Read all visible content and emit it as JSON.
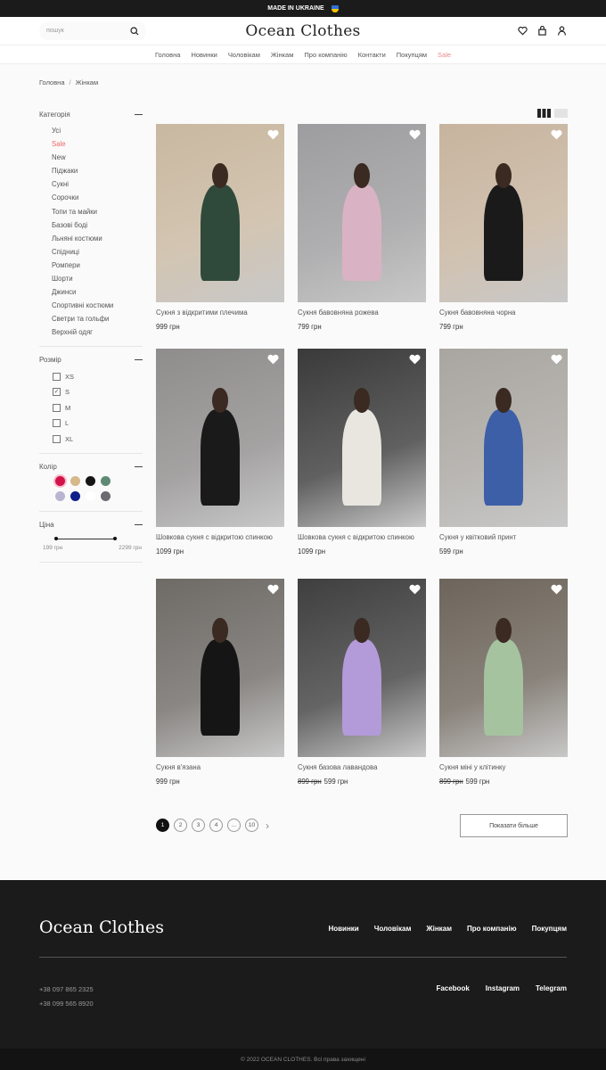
{
  "topbar": {
    "text": "MADE IN UKRAINE"
  },
  "header": {
    "search_placeholder": "пошук",
    "logo": "Ocean Clothes"
  },
  "nav": [
    "Головна",
    "Новинки",
    "Чоловікам",
    "Жінкам",
    "Про компанію",
    "Контакти",
    "Покупцям",
    "Sale"
  ],
  "breadcrumb": [
    "Головна",
    "Жінкам"
  ],
  "filters": {
    "category": {
      "title": "Категорія",
      "items": [
        "Усі",
        "Sale",
        "New",
        "Піджаки",
        "Сукні",
        "Сорочки",
        "Топи та майки",
        "Базові боді",
        "Льняні костюми",
        "Спідниці",
        "Ромпери",
        "Шорти",
        "Джинси",
        "Спортивні костюми",
        "Светри та гольфи",
        "Верхній одяг"
      ]
    },
    "size": {
      "title": "Розмір",
      "items": [
        {
          "label": "XS",
          "checked": false
        },
        {
          "label": "S",
          "checked": true
        },
        {
          "label": "M",
          "checked": false
        },
        {
          "label": "L",
          "checked": false
        },
        {
          "label": "XL",
          "checked": false
        }
      ]
    },
    "color": {
      "title": "Колір",
      "swatches": [
        "#d4134a",
        "#d6b88a",
        "#151515",
        "#5e8a74",
        "#b9b4d0",
        "#0f1f8a",
        "#ffffff",
        "#6b6c72"
      ]
    },
    "price": {
      "title": "Ціна",
      "min": "199 грн",
      "max": "2299 грн"
    }
  },
  "products": [
    {
      "name": "Сукня з відкритими плечима",
      "price": "999 грн",
      "old_price": null,
      "bg": "#c9b8a0",
      "dress": "#2f4a3a"
    },
    {
      "name": "Сукня бавовняна рожева",
      "price": "799 грн",
      "old_price": null,
      "bg": "#9d9c9e",
      "dress": "#d9b3c3"
    },
    {
      "name": "Сукня бавовняна чорна",
      "price": "799 грн",
      "old_price": null,
      "bg": "#c7b49e",
      "dress": "#1a1a1a"
    },
    {
      "name": "Шовкова сукня с відкритою спинкою",
      "price": "1099 грн",
      "old_price": null,
      "bg": "#8f8c8c",
      "dress": "#1b1a1a"
    },
    {
      "name": "Шовкова сукня с відкритою спинкою",
      "price": "1099 грн",
      "old_price": null,
      "bg": "#3a3a3a",
      "dress": "#e8e6df"
    },
    {
      "name": "Сукня у квітковий принт",
      "price": "599 грн",
      "old_price": null,
      "bg": "#a9a6a1",
      "dress": "#3d5fa8"
    },
    {
      "name": "Сукня в'язана",
      "price": "999 грн",
      "old_price": null,
      "bg": "#6e6a66",
      "dress": "#151515"
    },
    {
      "name": "Сукня базова лавандова",
      "price": "599 грн",
      "old_price": "899 грн",
      "bg": "#3f3f40",
      "dress": "#b39ad8"
    },
    {
      "name": "Сукня міні у клітинку",
      "price": "599 грн",
      "old_price": "899 грн",
      "bg": "#6d655b",
      "dress": "#a6c3a0"
    }
  ],
  "pagination": {
    "pages": [
      "1",
      "2",
      "3",
      "4",
      "...",
      "10"
    ],
    "current": "1"
  },
  "show_more": "Показати більше",
  "footer": {
    "logo": "Ocean Clothes",
    "links": [
      "Новинки",
      "Чоловікам",
      "Жінкам",
      "Про компанію",
      "Покупцям"
    ],
    "phones": [
      "+38 097 865 2325",
      "+38 099 565 8920"
    ],
    "social": [
      "Facebook",
      "Instagram",
      "Telegram"
    ],
    "copyright": "© 2022 OCEAN CLOTHES. Всі права захищені"
  }
}
